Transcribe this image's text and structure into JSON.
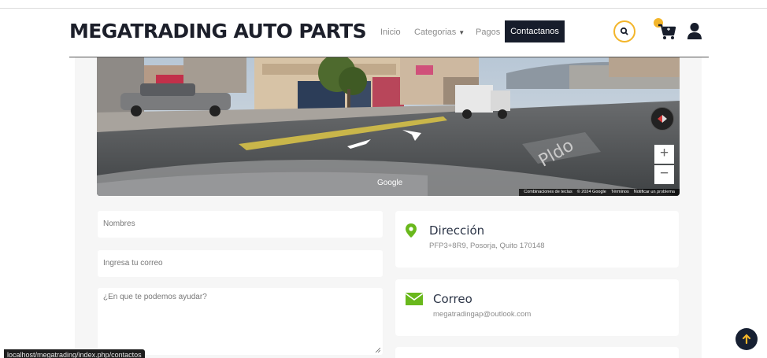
{
  "brand": {
    "name": "MEGATRADING AUTO PARTS"
  },
  "nav": {
    "items": [
      {
        "label": "Inicio"
      },
      {
        "label": "Categorias",
        "has_dropdown": true
      },
      {
        "label": "Pagos"
      }
    ],
    "cta_label": "Contactanos",
    "icons": [
      "search-icon",
      "cart-icon",
      "user-icon"
    ]
  },
  "map": {
    "logo": "Google",
    "footer": [
      "Combinaciones de teclas",
      "© 2024 Google",
      "Términos",
      "Notificar un problema"
    ],
    "zoom_in": "+",
    "zoom_out": "−",
    "compass_icon": "compass-icon"
  },
  "form": {
    "name_placeholder": "Nombres",
    "email_placeholder": "Ingresa tu correo",
    "message_placeholder": "¿En que te podemos ayudar?"
  },
  "contact": {
    "address": {
      "title": "Dirección",
      "value": "PFP3+8R9, Posorja, Quito 170148",
      "icon": "map-pin-icon"
    },
    "email": {
      "title": "Correo",
      "value": "megatradingap@outlook.com",
      "icon": "envelope-icon"
    }
  },
  "status_bar": {
    "url": "localhost/megatrading/index.php/contactos"
  },
  "colors": {
    "accent": "#f3b52a",
    "dark": "#171d2b",
    "green": "#69b81c"
  }
}
